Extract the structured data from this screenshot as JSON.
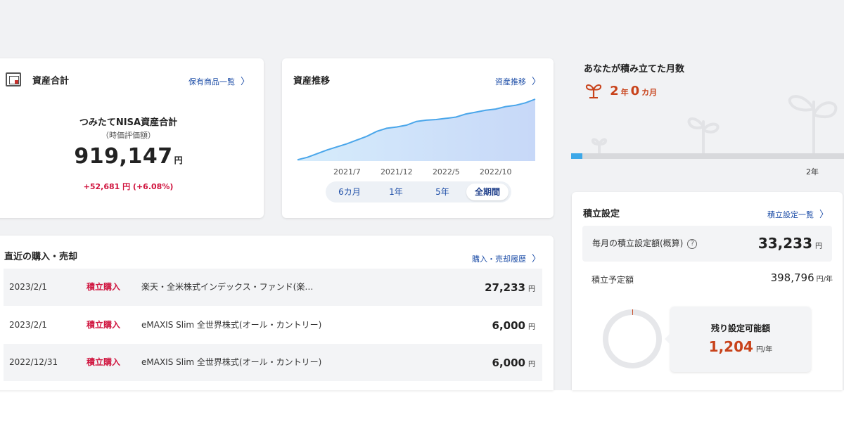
{
  "colors": {
    "accent_red": "#d0153f",
    "link_blue": "#1f4fa8",
    "orange": "#c8421a",
    "chart_fill": "#cfe0fb",
    "chart_line": "#4aa6ea",
    "progress": "#3da8e8"
  },
  "asset_total": {
    "title": "資産合計",
    "link": "保有商品一覧",
    "subtitle": "つみたてNISA資産合計",
    "note": "（時価評価額）",
    "value": "919,147",
    "unit": "円",
    "gain": "+52,681 円 (+6.08%)",
    "icon": "safe-icon"
  },
  "asset_trend": {
    "title": "資産推移",
    "link": "資産推移",
    "tabs": [
      {
        "label": "6カ月",
        "active": false
      },
      {
        "label": "1年",
        "active": false
      },
      {
        "label": "5年",
        "active": false
      },
      {
        "label": "全期間",
        "active": true
      }
    ]
  },
  "chart_data": {
    "type": "area",
    "x_tick_labels": [
      "2021/7",
      "2021/12",
      "2022/5",
      "2022/10"
    ],
    "x": [
      "2021/2",
      "2021/3",
      "2021/4",
      "2021/5",
      "2021/6",
      "2021/7",
      "2021/8",
      "2021/9",
      "2021/10",
      "2021/11",
      "2021/12",
      "2022/1",
      "2022/2",
      "2022/3",
      "2022/4",
      "2022/5",
      "2022/6",
      "2022/7",
      "2022/8",
      "2022/9",
      "2022/10",
      "2022/11",
      "2022/12",
      "2023/1",
      "2023/2"
    ],
    "values": [
      2,
      6,
      12,
      18,
      23,
      28,
      34,
      40,
      48,
      53,
      55,
      58,
      64,
      66,
      67,
      69,
      71,
      76,
      79,
      82,
      84,
      88,
      90,
      94,
      100
    ],
    "value_scale": "relative (no y-axis printed)",
    "grid": false,
    "legend": false
  },
  "transactions": {
    "title": "直近の購入・売却",
    "link": "購入・売却履歴",
    "rows": [
      {
        "date": "2023/2/1",
        "type": "積立購入",
        "fund": "楽天・全米株式インデックス・ファンド(楽…",
        "amount": "27,233",
        "unit": "円"
      },
      {
        "date": "2023/2/1",
        "type": "積立購入",
        "fund": "eMAXIS Slim 全世界株式(オール・カントリー)",
        "amount": "6,000",
        "unit": "円"
      },
      {
        "date": "2022/12/31",
        "type": "積立購入",
        "fund": "eMAXIS Slim 全世界株式(オール・カントリー)",
        "amount": "6,000",
        "unit": "円"
      }
    ]
  },
  "months": {
    "label": "あなたが積み立てた月数",
    "years": "2",
    "years_unit": "年",
    "months": "0",
    "months_unit": "カ月",
    "progress_fraction": 0.04,
    "progress_end_label": "2年",
    "icon": "sprout-icon"
  },
  "settings": {
    "title": "積立設定",
    "link": "積立設定一覧",
    "monthly_label": "毎月の積立設定額(概算)",
    "help_glyph": "?",
    "monthly_value": "33,233",
    "monthly_unit": "円",
    "planned_label": "積立予定額",
    "planned_value": "398,796",
    "planned_unit": "円/年",
    "remain_label": "残り設定可能額",
    "remain_value": "1,204",
    "remain_unit": "円/年",
    "remain_fraction": 0.003
  }
}
